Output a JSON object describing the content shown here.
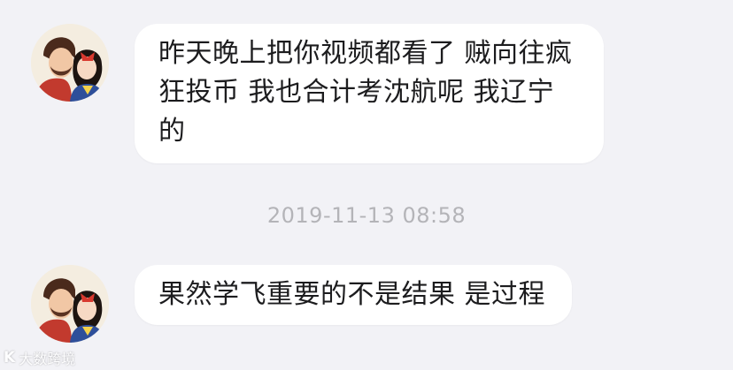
{
  "chat": {
    "messages": [
      {
        "sender_avatar": "avatar-couple-illustration",
        "text": "昨天晚上把你视频都看了 贼向往疯狂投币 我也合计考沈航呢 我辽宁的"
      },
      {
        "sender_avatar": "avatar-couple-illustration",
        "text": "果然学飞重要的不是结果 是过程"
      }
    ],
    "timestamp": "2019-11-13 08:58"
  },
  "watermark": {
    "logo_text": "K",
    "text": "大数跨境"
  },
  "colors": {
    "background": "#f2f2f6",
    "bubble": "#ffffff",
    "text": "#1c1c1e",
    "timestamp": "#b4b4b8"
  }
}
